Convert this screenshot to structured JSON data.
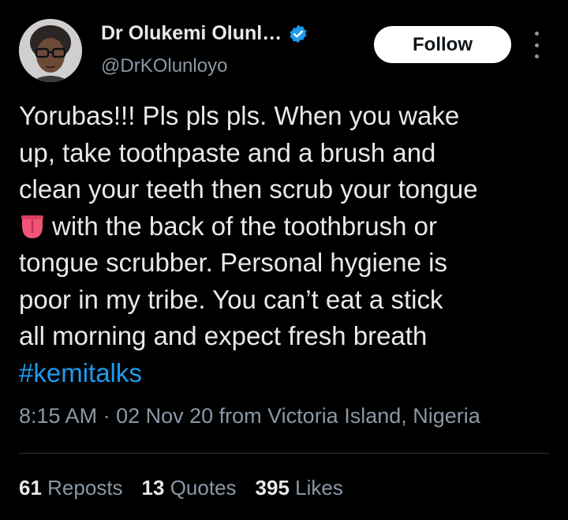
{
  "author": {
    "display_name": "Dr Olukemi Olunl…",
    "handle": "@DrKOlunloyo",
    "verified_icon": "verified-badge-icon",
    "avatar_icon": "profile-photo"
  },
  "actions": {
    "follow_label": "Follow",
    "more_icon": "more-options-icon"
  },
  "tweet": {
    "lines": [
      "Yorubas!!! Pls pls pls. When you wake",
      "up, take toothpaste and a brush and",
      "clean your teeth then scrub your tongue",
      "with the back of the toothbrush or",
      "tongue scrubber. Personal hygiene is",
      "poor in my tribe. You can’t eat a stick",
      "all morning and expect fresh breath"
    ],
    "emoji": "tongue-emoji",
    "hashtag": "#kemitalks"
  },
  "meta": {
    "time": "8:15 AM",
    "separator": " · ",
    "date": "02 Nov 20",
    "location": " from Victoria Island, Nigeria"
  },
  "stats": {
    "reposts_count": "61",
    "reposts_label": "Reposts",
    "quotes_count": "13",
    "quotes_label": "Quotes",
    "likes_count": "395",
    "likes_label": "Likes"
  },
  "colors": {
    "background": "#000000",
    "text": "#e7e9ea",
    "secondary": "#8b98a5",
    "link": "#1d9bf0",
    "verified": "#1d9bf0",
    "follow_bg": "#ffffff"
  }
}
